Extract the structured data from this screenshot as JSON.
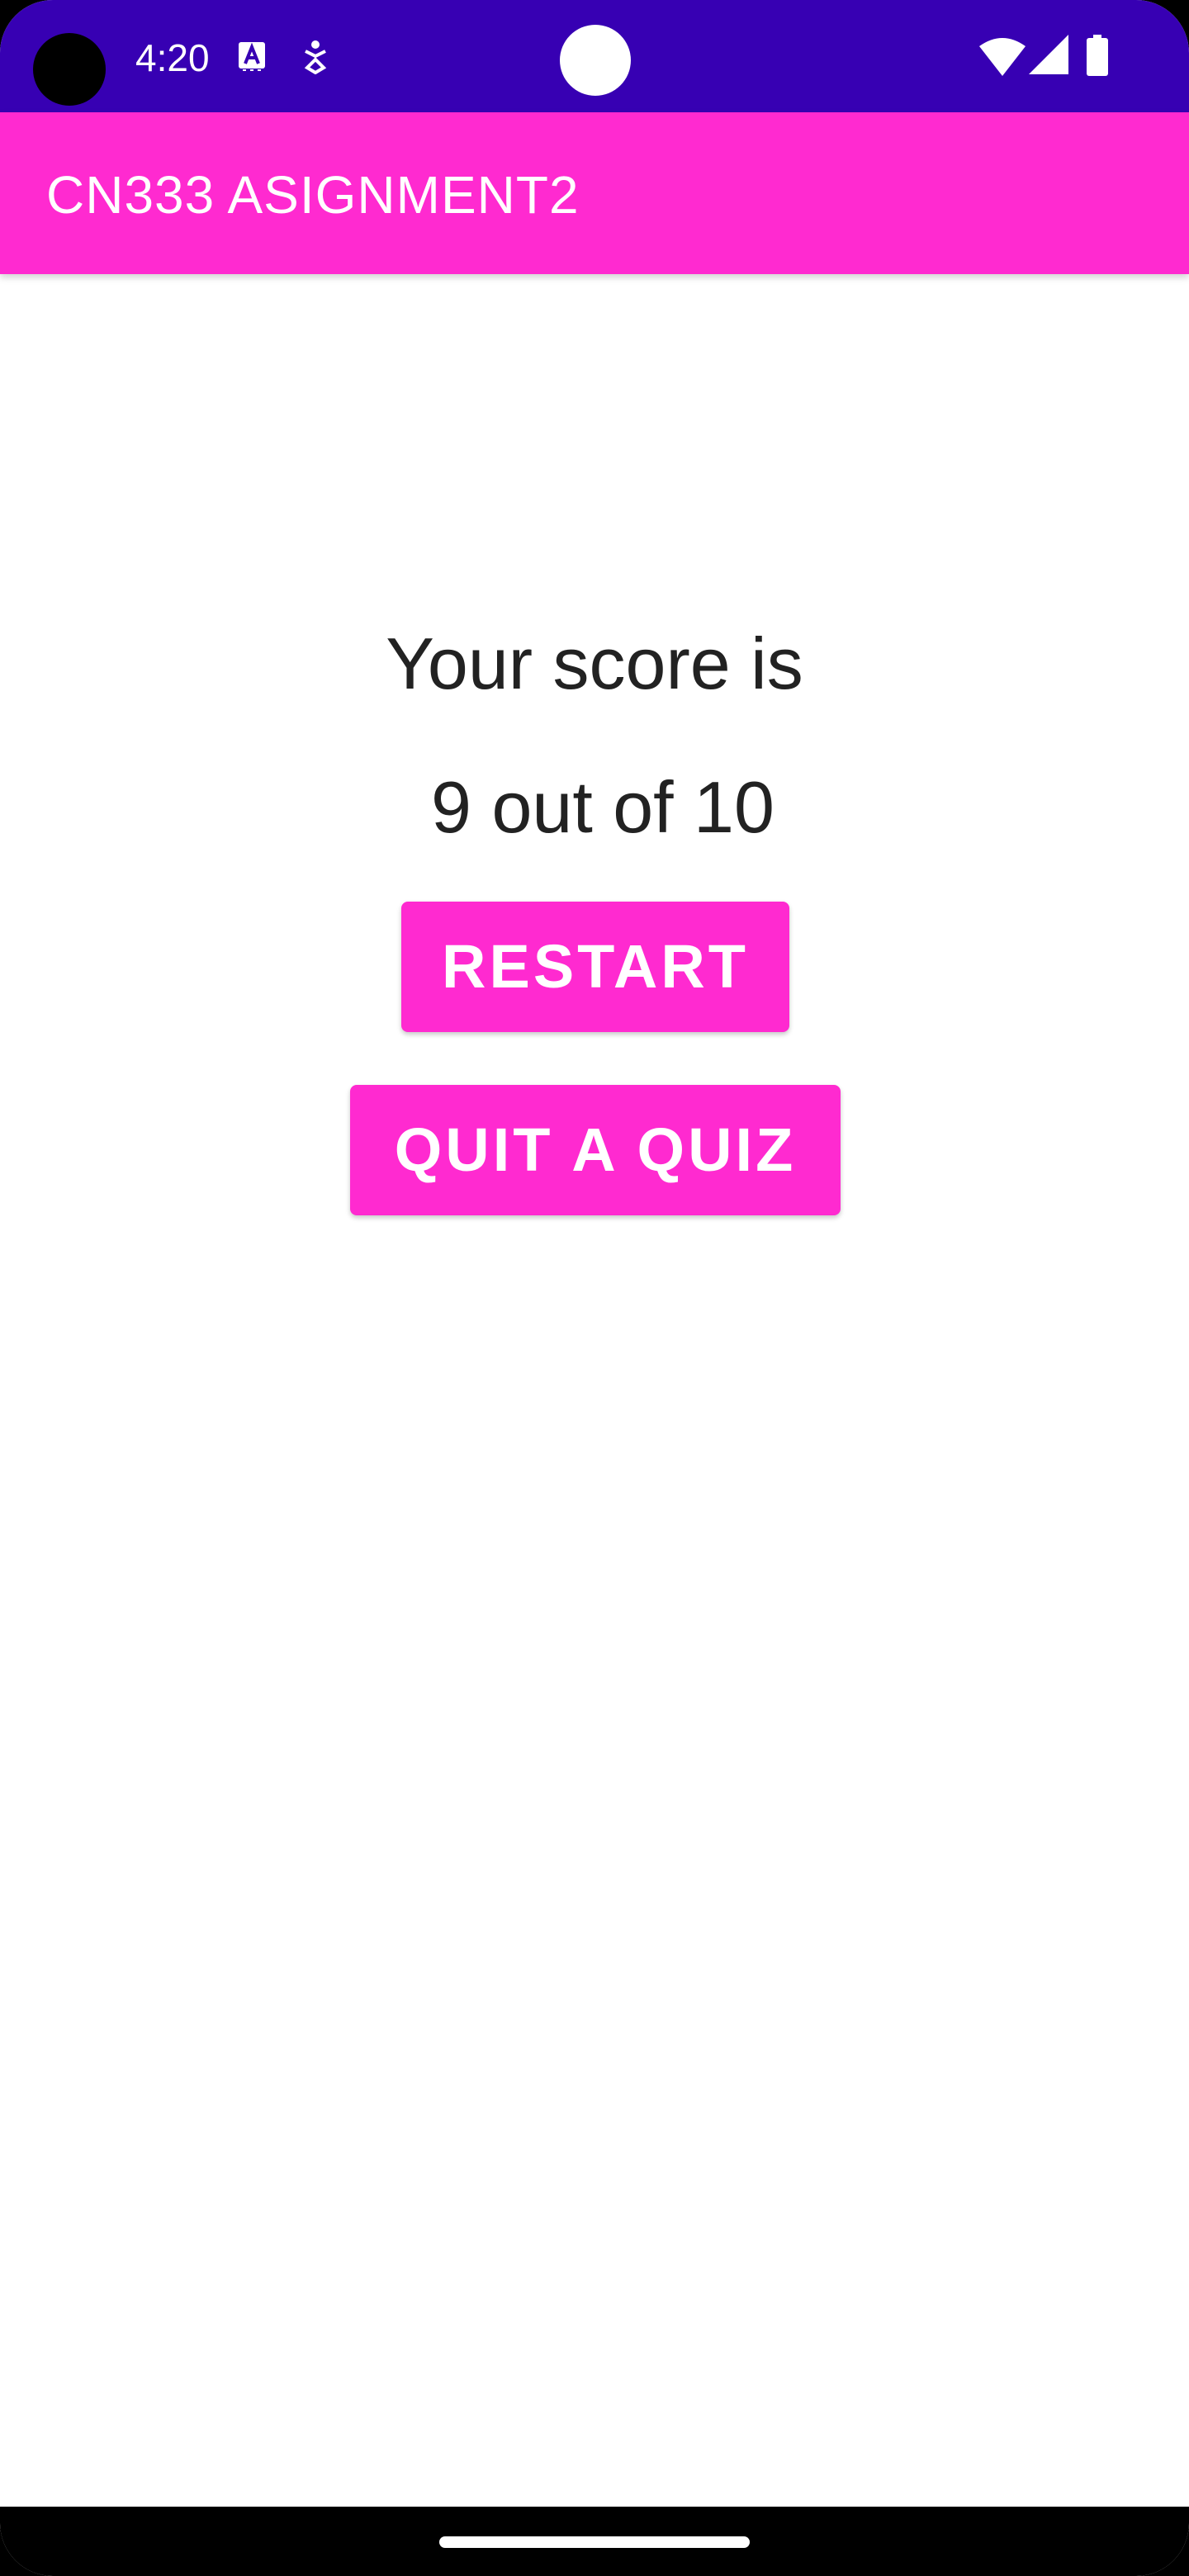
{
  "status_bar": {
    "time": "4:20",
    "color": "#3700b3",
    "icons": [
      "text-recognition-icon",
      "accessibility-icon",
      "wifi-icon",
      "cellular-signal-icon",
      "battery-icon"
    ]
  },
  "app_bar": {
    "title": "CN333 ASIGNMENT2",
    "color": "#ff2ad0"
  },
  "main": {
    "score_label": "Your score is",
    "score_value": "9 out of 10",
    "restart_label": "RESTART",
    "quit_label": "QUIT A QUIZ",
    "button_color": "#ff2ad0"
  },
  "nav_bar": {
    "color": "#000000"
  }
}
